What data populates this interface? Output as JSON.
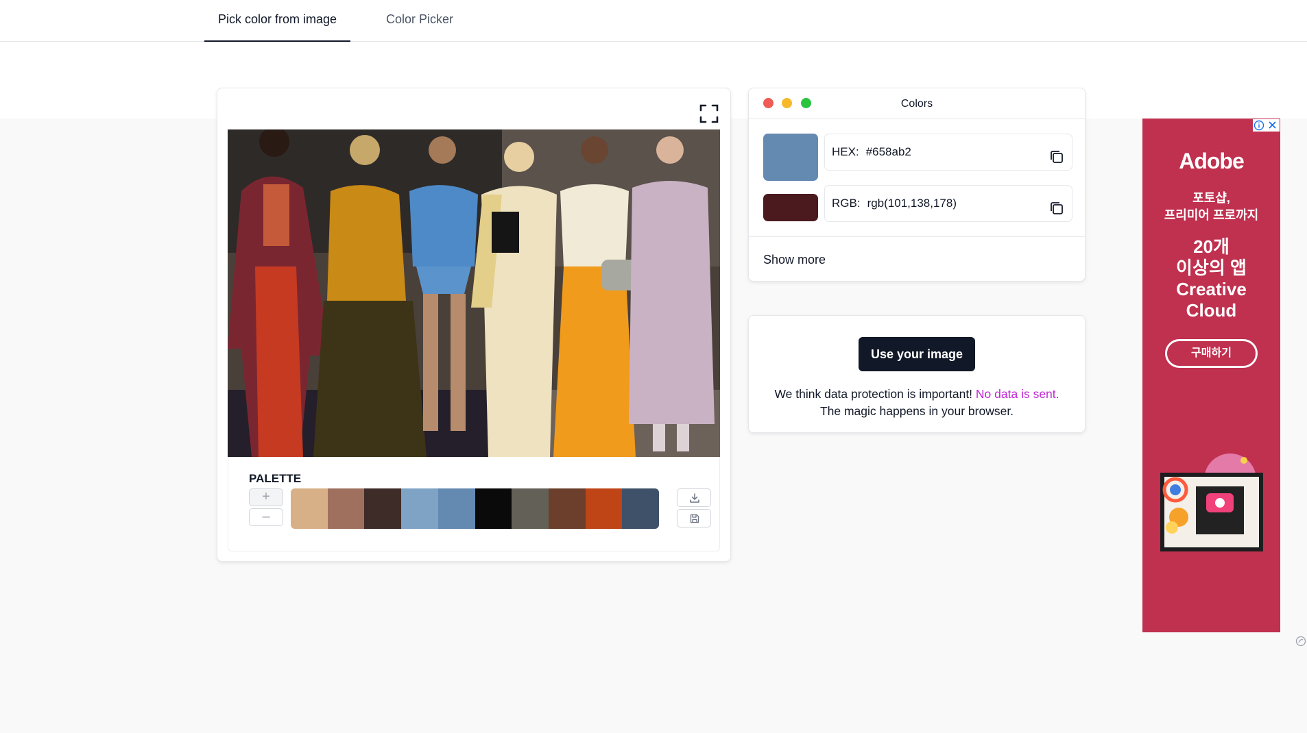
{
  "tabs": [
    {
      "label": "Pick color from image",
      "active": true
    },
    {
      "label": "Color Picker",
      "active": false
    }
  ],
  "image_card": {
    "palette": {
      "title": "PALETTE",
      "plus_label": "+",
      "minus_label": "–",
      "colors": [
        "#d8b088",
        "#a0705f",
        "#3e2c28",
        "#7fa3c4",
        "#658ab2",
        "#0b0a0b",
        "#636157",
        "#6b3f2c",
        "#bf4516",
        "#3f5169"
      ]
    }
  },
  "colors_panel": {
    "title": "Colors",
    "swatch_primary": "#658ab2",
    "swatch_secondary": "#4b1a1f",
    "hex": {
      "label": "HEX:",
      "value": "#658ab2"
    },
    "rgb": {
      "label": "RGB:",
      "value": "rgb(101,138,178)"
    },
    "show_more": "Show more"
  },
  "upload": {
    "button": "Use your image",
    "text_before": "We think data protection is important!",
    "highlight": "No data is sent.",
    "text_after": "The magic happens in your browser."
  },
  "ad": {
    "brand": "Adobe",
    "line1a": "포토샵,",
    "line1b": "프리미어 프로까지",
    "line2a": "20개",
    "line2b": "이상의 앱",
    "line2c": "Creative",
    "line2d": "Cloud",
    "cta": "구매하기",
    "background": "#c0304f"
  }
}
